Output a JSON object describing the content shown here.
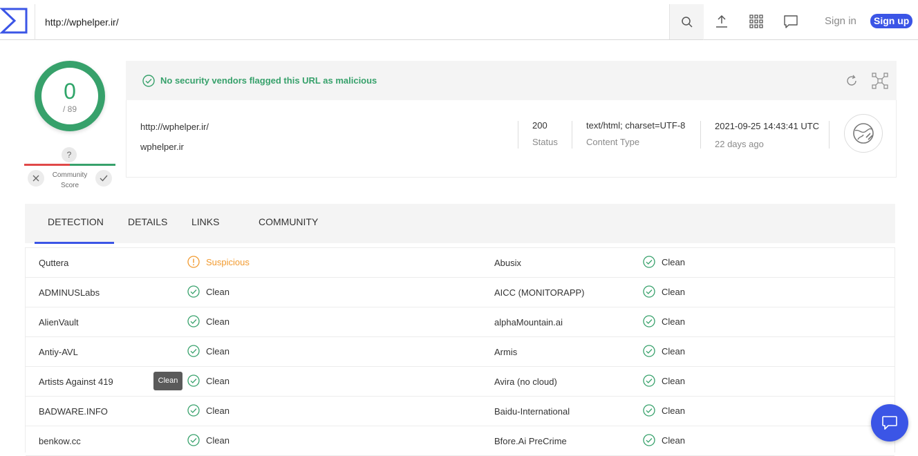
{
  "header": {
    "search_value": "http://wphelper.ir/",
    "signin_label": "Sign in",
    "signup_label": "Sign up"
  },
  "score": {
    "detections": "0",
    "total": "/ 89",
    "community_q": "?",
    "community_label": "Community Score"
  },
  "banner": {
    "message": "No security vendors flagged this URL as malicious"
  },
  "info": {
    "url": "http://wphelper.ir/",
    "domain": "wphelper.ir",
    "status_value": "200",
    "status_label": "Status",
    "content_type_value": "text/html; charset=UTF-8",
    "content_type_label": "Content Type",
    "date_value": "2021-09-25 14:43:41 UTC",
    "date_ago": "22 days ago"
  },
  "tabs": [
    "DETECTION",
    "DETAILS",
    "LINKS",
    "COMMUNITY"
  ],
  "tooltip": "Clean",
  "colors": {
    "accent": "#3b55e6",
    "clean": "#37a16b",
    "suspicious": "#f29a2e"
  },
  "rows": [
    {
      "left": {
        "vendor": "Quttera",
        "result": "Suspicious",
        "status": "suspicious"
      },
      "right": {
        "vendor": "Abusix",
        "result": "Clean",
        "status": "clean"
      }
    },
    {
      "left": {
        "vendor": "ADMINUSLabs",
        "result": "Clean",
        "status": "clean"
      },
      "right": {
        "vendor": "AICC (MONITORAPP)",
        "result": "Clean",
        "status": "clean"
      }
    },
    {
      "left": {
        "vendor": "AlienVault",
        "result": "Clean",
        "status": "clean"
      },
      "right": {
        "vendor": "alphaMountain.ai",
        "result": "Clean",
        "status": "clean"
      }
    },
    {
      "left": {
        "vendor": "Antiy-AVL",
        "result": "Clean",
        "status": "clean"
      },
      "right": {
        "vendor": "Armis",
        "result": "Clean",
        "status": "clean"
      }
    },
    {
      "left": {
        "vendor": "Artists Against 419",
        "result": "Clean",
        "status": "clean"
      },
      "right": {
        "vendor": "Avira (no cloud)",
        "result": "Clean",
        "status": "clean"
      }
    },
    {
      "left": {
        "vendor": "BADWARE.INFO",
        "result": "Clean",
        "status": "clean"
      },
      "right": {
        "vendor": "Baidu-International",
        "result": "Clean",
        "status": "clean"
      }
    },
    {
      "left": {
        "vendor": "benkow.cc",
        "result": "Clean",
        "status": "clean"
      },
      "right": {
        "vendor": "Bfore.Ai PreCrime",
        "result": "Clean",
        "status": "clean"
      }
    }
  ]
}
